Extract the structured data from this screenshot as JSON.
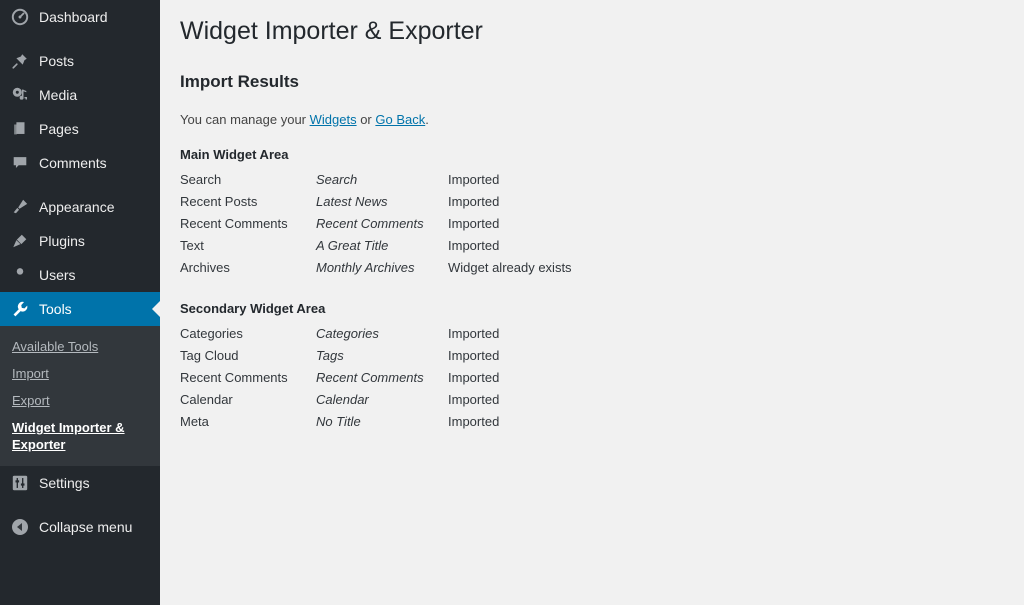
{
  "sidebar": {
    "items": [
      {
        "label": "Dashboard",
        "icon": "dashboard-icon",
        "name": "sidebar-item-dashboard"
      },
      {
        "label": "Posts",
        "icon": "pin-icon",
        "name": "sidebar-item-posts"
      },
      {
        "label": "Media",
        "icon": "media-icon",
        "name": "sidebar-item-media"
      },
      {
        "label": "Pages",
        "icon": "pages-icon",
        "name": "sidebar-item-pages"
      },
      {
        "label": "Comments",
        "icon": "comment-icon",
        "name": "sidebar-item-comments"
      },
      {
        "label": "Appearance",
        "icon": "paintbrush-icon",
        "name": "sidebar-item-appearance"
      },
      {
        "label": "Plugins",
        "icon": "plug-icon",
        "name": "sidebar-item-plugins"
      },
      {
        "label": "Users",
        "icon": "user-icon",
        "name": "sidebar-item-users"
      },
      {
        "label": "Tools",
        "icon": "wrench-icon",
        "name": "sidebar-item-tools"
      },
      {
        "label": "Settings",
        "icon": "sliders-icon",
        "name": "sidebar-item-settings"
      }
    ],
    "submenu": [
      {
        "label": "Available Tools",
        "current": false
      },
      {
        "label": "Import",
        "current": false
      },
      {
        "label": "Export",
        "current": false
      },
      {
        "label": "Widget Importer & Exporter",
        "current": true
      }
    ],
    "collapse": {
      "label": "Collapse menu",
      "icon": "collapse-arrow-icon"
    },
    "active_color": "#0073aa",
    "background": "#23282d",
    "submenu_background": "#32373c"
  },
  "main": {
    "page_title": "Widget Importer & Exporter",
    "section_title": "Import Results",
    "intro": {
      "prefix": "You can manage your ",
      "link_widgets": "Widgets",
      "middle": " or ",
      "link_goback": "Go Back",
      "suffix": "."
    },
    "areas": [
      {
        "title": "Main Widget Area",
        "rows": [
          {
            "type": "Search",
            "title": "Search",
            "status": "Imported",
            "state": "imported"
          },
          {
            "type": "Recent Posts",
            "title": "Latest News",
            "status": "Imported",
            "state": "imported"
          },
          {
            "type": "Recent Comments",
            "title": "Recent Comments",
            "status": "Imported",
            "state": "imported"
          },
          {
            "type": "Text",
            "title": "A Great Title",
            "status": "Imported",
            "state": "imported"
          },
          {
            "type": "Archives",
            "title": "Monthly Archives",
            "status": "Widget already exists",
            "state": "exists"
          }
        ]
      },
      {
        "title": "Secondary Widget Area",
        "rows": [
          {
            "type": "Categories",
            "title": "Categories",
            "status": "Imported",
            "state": "imported"
          },
          {
            "type": "Tag Cloud",
            "title": "Tags",
            "status": "Imported",
            "state": "imported"
          },
          {
            "type": "Recent Comments",
            "title": "Recent Comments",
            "status": "Imported",
            "state": "imported"
          },
          {
            "type": "Calendar",
            "title": "Calendar",
            "status": "Imported",
            "state": "imported"
          },
          {
            "type": "Meta",
            "title": "No Title",
            "status": "Imported",
            "state": "imported"
          }
        ]
      }
    ],
    "colors": {
      "imported": "#0a6b1c",
      "exists": "#e08f3c",
      "link": "#0073aa",
      "background": "#f1f1f1"
    }
  }
}
